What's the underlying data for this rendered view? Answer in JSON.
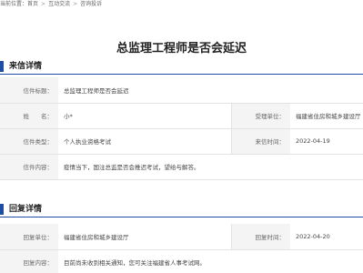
{
  "breadcrumb": {
    "prefix": "当前位置：",
    "items": [
      "首页",
      "互动交流",
      "咨询投诉"
    ],
    "separator": ">"
  },
  "page_title": "总监理工程师是否会延迟",
  "letter_section": {
    "title": "来信详情",
    "rows": {
      "subject": {
        "label": "信件标题：",
        "value": "总监理工程师是否会延迟"
      },
      "name": {
        "label": "姓　　名：",
        "value": "小*"
      },
      "handling_unit": {
        "label": "受理单位：",
        "value": "福建省住房和城乡建设厅"
      },
      "type": {
        "label": "信件类型：",
        "value": "个人执业资格考试"
      },
      "letter_time": {
        "label": "来信时间：",
        "value": "2022-04-19"
      },
      "content": {
        "label": "信件内容：",
        "value": "疫情当下，国注总监是否会推迟考试，望给与解答。"
      }
    }
  },
  "reply_section": {
    "title": "回复详情",
    "rows": {
      "unit": {
        "label": "回复单位：",
        "value": "福建省住房和城乡建设厅"
      },
      "time": {
        "label": "回复时间：",
        "value": "2022-04-20"
      },
      "content": {
        "label": "回复内容：",
        "value": "目前尚未收到相关通知，您可关注福建省人事考试网。"
      }
    }
  },
  "colors": {
    "accent": "#1d4ea3",
    "label_bg": "#f4f4f4",
    "border": "#e3e3e3"
  }
}
